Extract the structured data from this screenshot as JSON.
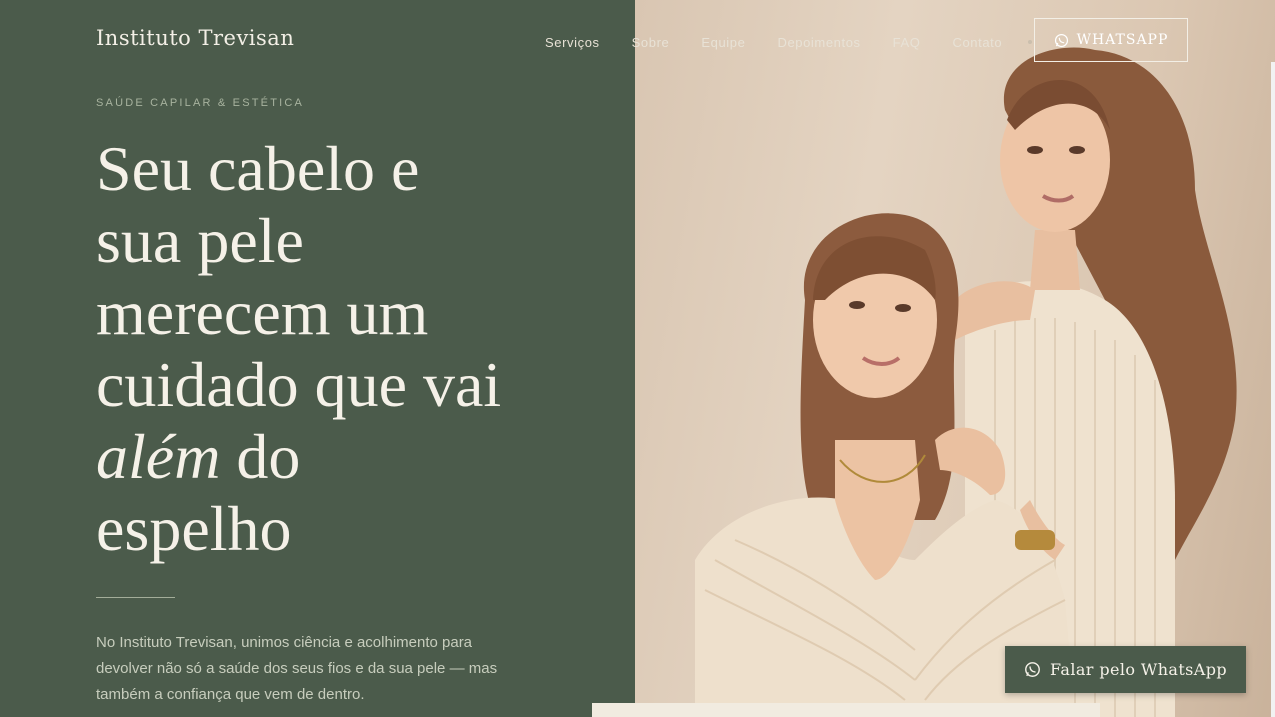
{
  "brand": {
    "name": "Instituto Trevisan"
  },
  "nav": {
    "items": [
      {
        "label": "Serviços"
      },
      {
        "label": "Sobre"
      },
      {
        "label": "Equipe"
      },
      {
        "label": "Depoimentos"
      },
      {
        "label": "FAQ"
      },
      {
        "label": "Contato"
      }
    ],
    "cta_label": "WHATSAPP",
    "cta_icon": "whatsapp-icon"
  },
  "hero": {
    "eyebrow": "SAÚDE CAPILAR & ESTÉTICA",
    "headline": {
      "line1": "Seu cabelo e",
      "line2": "sua pele",
      "line3": "merecem um",
      "line4": "cuidado que vai",
      "line5_em": "além",
      "line5_rest": " do",
      "line6": "espelho"
    },
    "intro": "No Instituto Trevisan, unimos ciência e acolhimento para devolver não só a saúde dos seus fios e da sua pele — mas também a confiança que vem de dentro."
  },
  "floating_cta": {
    "label": "Falar pelo WhatsApp",
    "icon": "whatsapp-icon"
  },
  "colors": {
    "panel_green": "#4b5b4b",
    "cream_text": "#f5f1e8",
    "photo_beige": "#d9c6b2"
  }
}
